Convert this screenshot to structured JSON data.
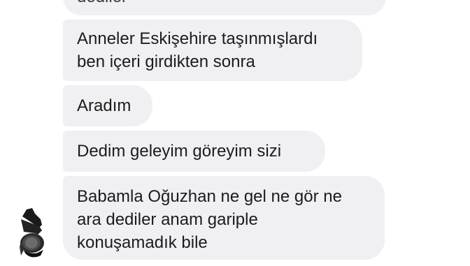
{
  "messages": [
    {
      "lines": [
        "dediler"
      ]
    },
    {
      "lines": [
        "Anneler Eskişehire taşınmışlardı",
        "ben içeri girdikten sonra"
      ]
    },
    {
      "lines": [
        "Aradım"
      ]
    },
    {
      "lines": [
        "Dedim geleyim göreyim sizi"
      ]
    },
    {
      "lines": [
        "Babamla Oğuzhan ne gel ne gör ne",
        "ara dediler anam gariple",
        "konuşamadık bile"
      ]
    }
  ],
  "sender": {
    "avatar_icon": "avatar-icon"
  },
  "colors": {
    "bubble": "#f0f0f3",
    "text": "#1c1c1c",
    "background": "#ffffff"
  }
}
